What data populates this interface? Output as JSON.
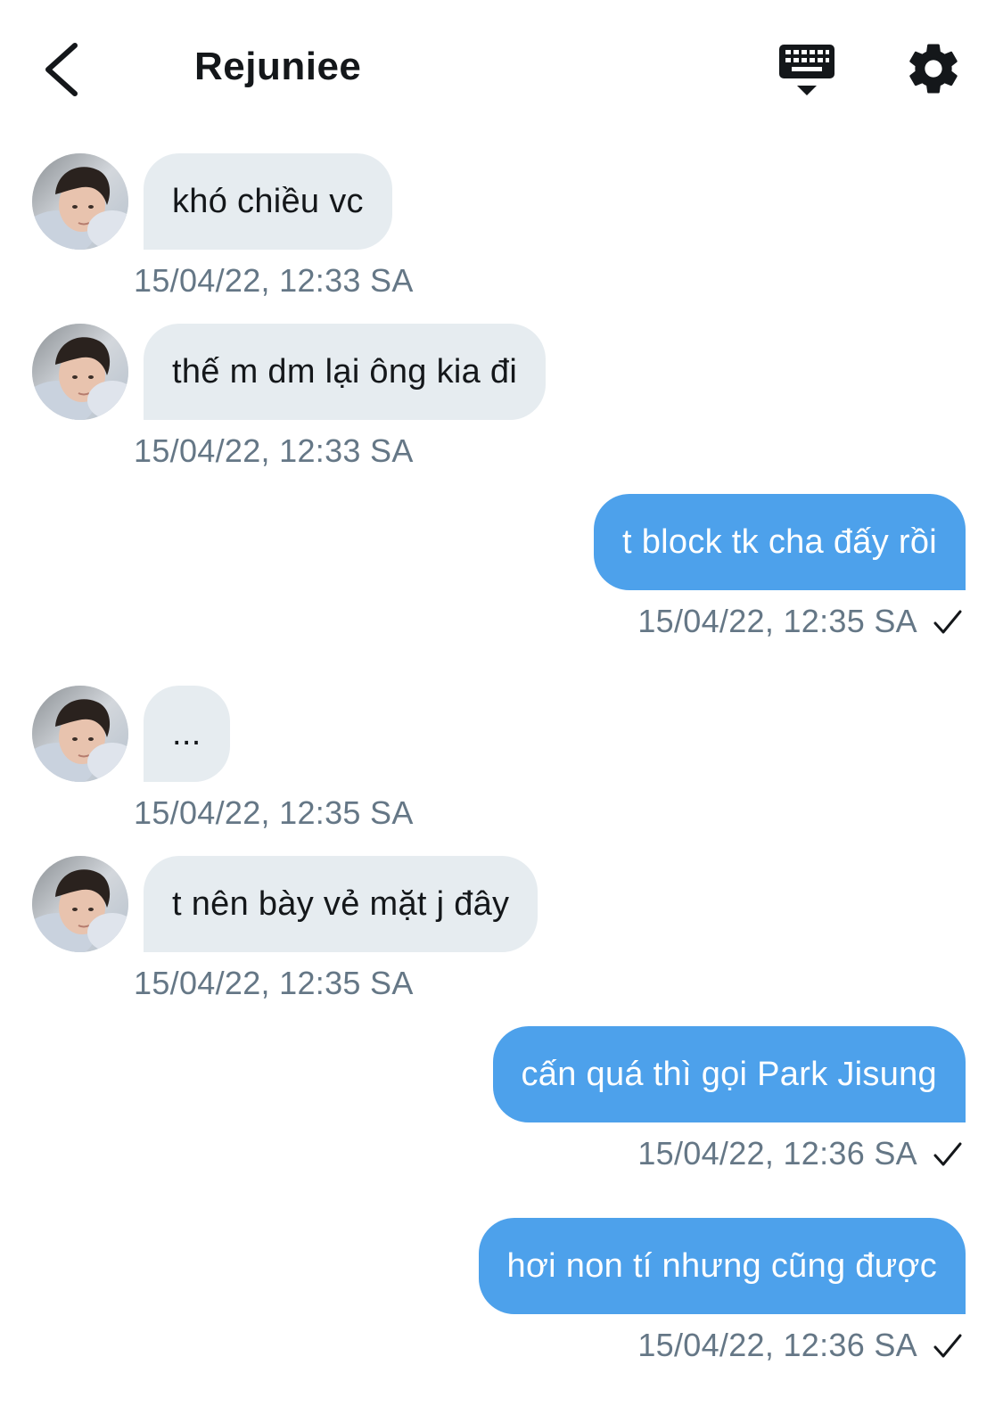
{
  "header": {
    "title": "Rejuniee"
  },
  "messages": [
    {
      "dir": "in",
      "text": "khó chiều vc",
      "time": "15/04/22, 12:33 SA"
    },
    {
      "dir": "in",
      "text": "thế m dm lại ông kia đi",
      "time": "15/04/22, 12:33 SA"
    },
    {
      "dir": "out",
      "text": "t block tk cha đấy rồi",
      "time": "15/04/22, 12:35 SA",
      "status": "sent"
    },
    {
      "dir": "in",
      "text": "...",
      "time": "15/04/22, 12:35 SA"
    },
    {
      "dir": "in",
      "text": "t nên bày vẻ mặt j đây",
      "time": "15/04/22, 12:35 SA"
    },
    {
      "dir": "out",
      "text": "cấn quá thì gọi Park Jisung",
      "time": "15/04/22, 12:36 SA",
      "status": "sent"
    },
    {
      "dir": "out",
      "text": "hơi non tí nhưng cũng được",
      "time": "15/04/22, 12:36 SA",
      "status": "sent"
    }
  ],
  "icons": {
    "back": "back-arrow-icon",
    "keyboard": "keyboard-icon",
    "settings": "gear-icon",
    "read": "checkmark-icon"
  },
  "colors": {
    "incoming_bubble": "#e6ecf0",
    "outgoing_bubble": "#4da1eb",
    "timestamp": "#657786",
    "text": "#14171a"
  }
}
